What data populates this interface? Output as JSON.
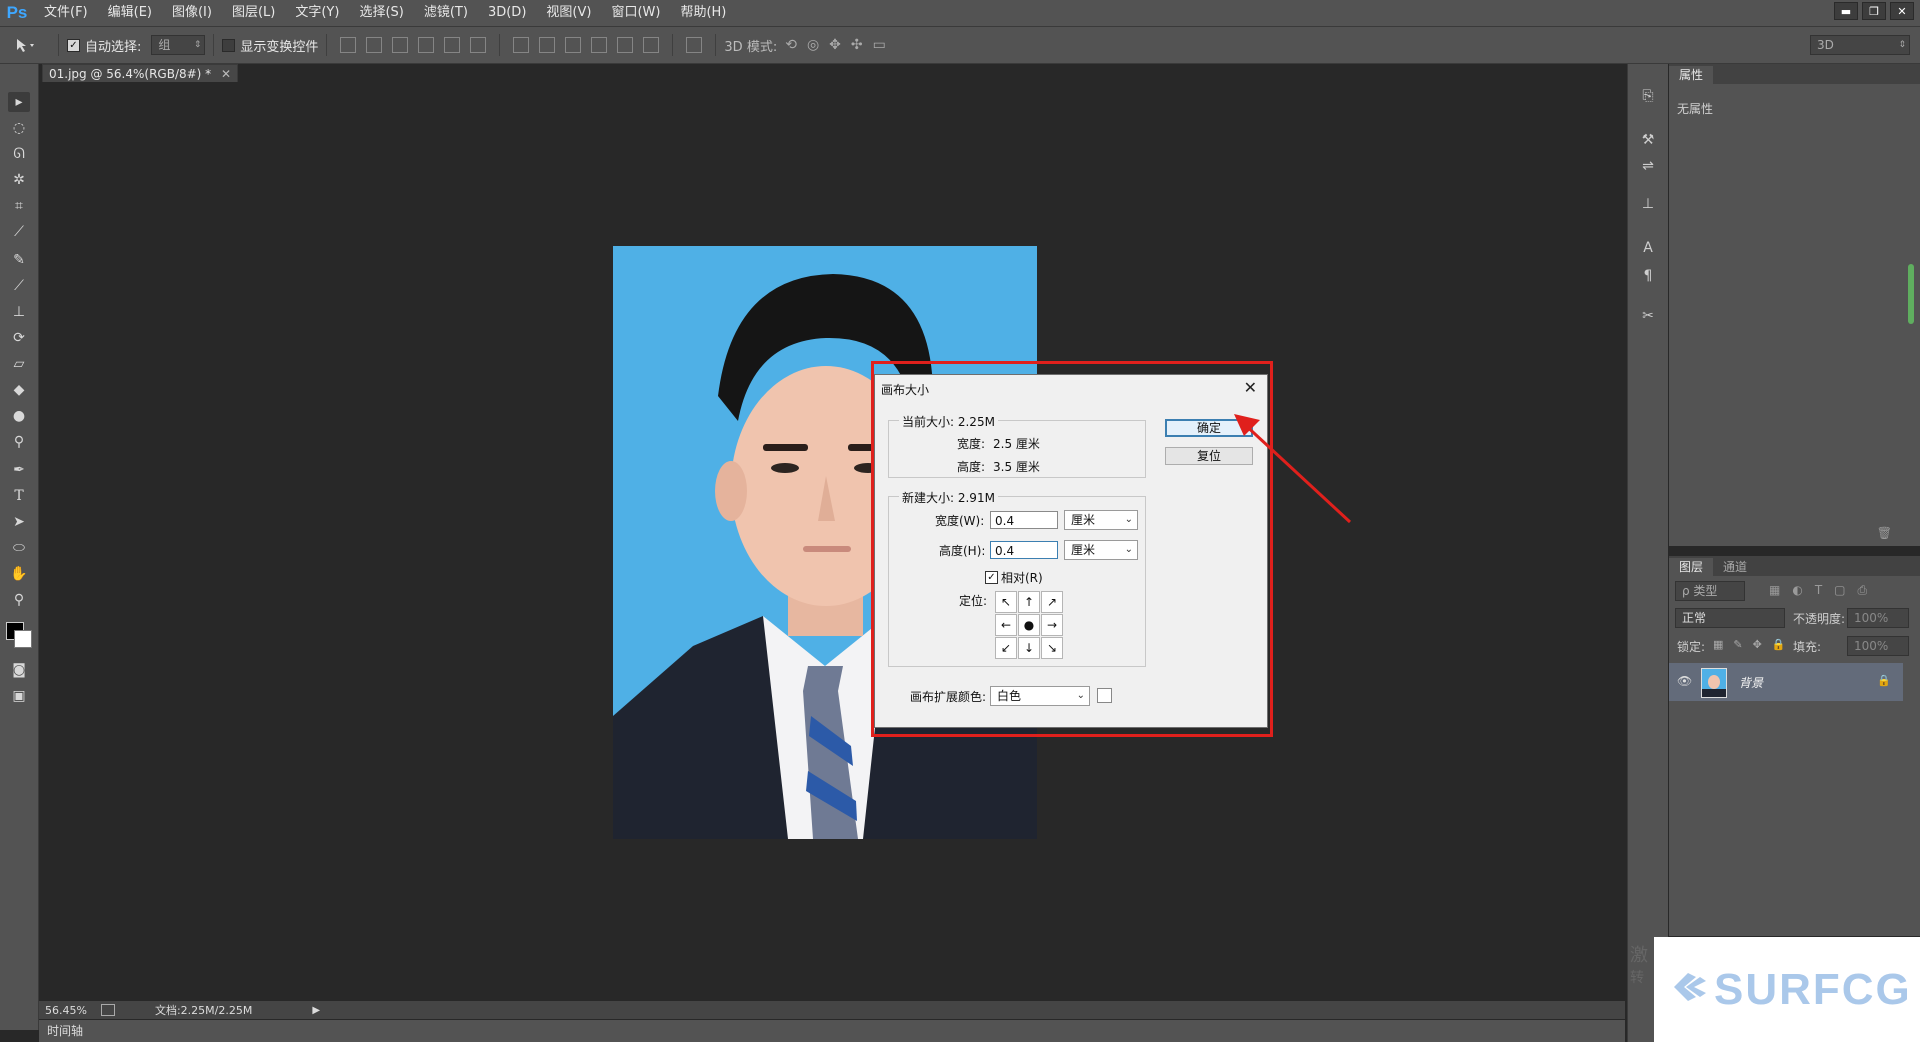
{
  "menubar": {
    "logo": "Ps",
    "items": [
      "文件(F)",
      "编辑(E)",
      "图像(I)",
      "图层(L)",
      "文字(Y)",
      "选择(S)",
      "滤镜(T)",
      "3D(D)",
      "视图(V)",
      "窗口(W)",
      "帮助(H)"
    ],
    "win_min": "▬",
    "win_restore": "❐",
    "win_close": "✕"
  },
  "options": {
    "auto_select_label": "自动选择:",
    "auto_select_value": "组",
    "show_transform_label": "显示变换控件",
    "mode_3d_label": "3D 模式:",
    "workspace_value": "3D"
  },
  "document": {
    "tab_label": "01.jpg @ 56.4%(RGB/8#) *"
  },
  "status": {
    "zoom": "56.45%",
    "doc_info": "文档:2.25M/2.25M"
  },
  "timeline": {
    "label": "时间轴"
  },
  "properties": {
    "tab_label": "属性",
    "empty_text": "无属性"
  },
  "layers": {
    "tabs": [
      "图层",
      "通道"
    ],
    "filter_label": "ρ 类型",
    "blend_mode": "正常",
    "opacity_label": "不透明度:",
    "opacity_value": "100%",
    "lock_label": "锁定:",
    "fill_label": "填充:",
    "fill_value": "100%",
    "layer_name": "背景"
  },
  "dialog": {
    "title": "画布大小",
    "close": "✕",
    "current_size_label": "当前大小: 2.25M",
    "current_width_label": "宽度:",
    "current_width_value": "2.5 厘米",
    "current_height_label": "高度:",
    "current_height_value": "3.5 厘米",
    "new_size_label": "新建大小: 2.91M",
    "width_label": "宽度(W):",
    "width_value": "0.4",
    "width_unit": "厘米",
    "height_label": "高度(H):",
    "height_value": "0.4",
    "height_unit": "厘米",
    "relative_label": "相对(R)",
    "relative_checked": true,
    "anchor_label": "定位:",
    "anchor_arrows": [
      "↖",
      "↑",
      "↗",
      "←",
      "●",
      "→",
      "↙",
      "↓",
      "↘"
    ],
    "ext_color_label": "画布扩展颜色:",
    "ext_color_value": "白色",
    "ok_label": "确定",
    "reset_label": "复位"
  },
  "watermark": {
    "brand": "SURFCG",
    "corner_text_1": "激",
    "corner_text_2": "转"
  },
  "colors": {
    "highlight_red": "#e0201c",
    "photo_bg": "#4fb0e6",
    "accent_blue": "#3c7fb1"
  }
}
